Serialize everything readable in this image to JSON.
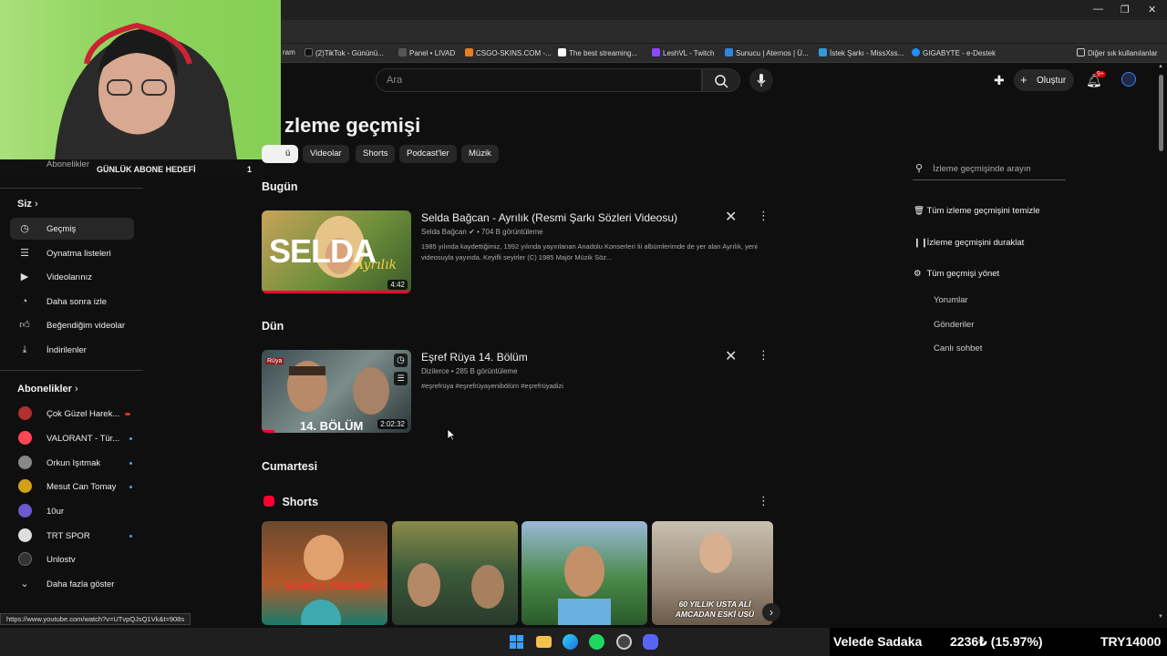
{
  "browser": {
    "bookmarks": [
      {
        "label": "ram",
        "color": "#c13584"
      },
      {
        "label": "(2)TikTok - Gününü...",
        "color": "#111111"
      },
      {
        "label": "Panel • LIVAD",
        "color": "#444444"
      },
      {
        "label": "CSGO-SKINS.COM -...",
        "color": "#e67e22"
      },
      {
        "label": "The best streaming...",
        "color": "#ffffff"
      },
      {
        "label": "LeshVL - Twitch",
        "color": "#9146ff"
      },
      {
        "label": "Sunucu | Aternos | Ü...",
        "color": "#2e86de"
      },
      {
        "label": "İstek Şarkı - MissXss...",
        "color": "#3498db"
      },
      {
        "label": "GIGABYTE - e-Destek",
        "color": "#1e90ff"
      },
      {
        "label": "Diğer sık kullanılanlar",
        "color": "#f1c40f"
      }
    ],
    "status_url": "https://www.youtube.com/watch?v=UTvpQJsQ1Vk&t=908s"
  },
  "header": {
    "search_placeholder": "Ara",
    "create_label": "Oluştur",
    "notifications_badge": "9+"
  },
  "overlay": {
    "goal_label": "GÜNLÜK ABONE HEDEFİ",
    "goal_value": "1"
  },
  "sidebar": {
    "subscriptions_top": "Abonelikler",
    "you_header": "Siz",
    "you_items": [
      {
        "label": "Geçmiş",
        "icon": "history-icon"
      },
      {
        "label": "Oynatma listeleri",
        "icon": "playlist-icon"
      },
      {
        "label": "Videolarınız",
        "icon": "your-videos-icon"
      },
      {
        "label": "Daha sonra izle",
        "icon": "watch-later-icon"
      },
      {
        "label": "Beğendiğim videolar",
        "icon": "like-icon"
      },
      {
        "label": "İndirilenler",
        "icon": "download-icon"
      }
    ],
    "subs_header": "Abonelikler",
    "subs": [
      {
        "label": "Çok Güzel Harek...",
        "color": "#b03030",
        "live": true
      },
      {
        "label": "VALORANT - Tür...",
        "color": "#ff4655",
        "live": false
      },
      {
        "label": "Orkun Işıtmak",
        "color": "#888888",
        "live": false
      },
      {
        "label": "Mesut Can Tomay",
        "color": "#d4a017",
        "live": false
      },
      {
        "label": "10ur",
        "color": "#6a5acd",
        "live": false
      },
      {
        "label": "TRT SPOR",
        "color": "#dddddd",
        "live": false
      },
      {
        "label": "Unlostv",
        "color": "#333333",
        "live": false
      }
    ],
    "show_more": "Daha fazla göster"
  },
  "main": {
    "title": "İzleme geçmişi",
    "title_visible": "zleme geçmişi",
    "chips": [
      "ü",
      "Videolar",
      "Shorts",
      "Podcast'ler",
      "Müzik"
    ],
    "sections": {
      "today": "Bugün",
      "yesterday": "Dün",
      "saturday": "Cumartesi"
    },
    "videos": [
      {
        "title": "Selda Bağcan - Ayrılık (Resmi Şarkı Sözleri Videosu)",
        "channel": "Selda Bağcan",
        "views": "704 B görüntüleme",
        "description": "1985 yılında kaydettiğimiz, 1992 yılında yayınlanan Anadolu Konserleri Iii albümlerimde de yer alan Ayrılık, yeni videosuyla yayında. Keyifli seyirler (C) 1985 Majör Müzik Söz...",
        "duration": "4:42",
        "thumb_text": "SELDA",
        "thumb_script": "Ayrılık"
      },
      {
        "title": "Eşref Rüya 14. Bölüm",
        "channel": "Dizilerce",
        "views": "285 B görüntüleme",
        "description": "#eşrefrüya #eşrefrüyayenibölüm #eşrefrüyadizi",
        "duration": "2:02:32",
        "thumb_text": "14. BÖLÜM",
        "thumb_badge": "Rüya"
      }
    ],
    "shorts_title": "Shorts",
    "shorts": [
      {
        "overlay": "SCHOLL THEORY"
      },
      {
        "overlay": ""
      },
      {
        "overlay": ""
      },
      {
        "overlay": "60 YILLIK USTA ALİ AMCADAN ESKİ USÜ"
      }
    ]
  },
  "right_panel": {
    "search_placeholder": "İzleme geçmişinde arayın",
    "clear": "Tüm izleme geçmişini temizle",
    "pause": "İzleme geçmişini duraklat",
    "manage": "Tüm geçmişi yönet",
    "sub_items": [
      "Yorumlar",
      "Gönderiler",
      "Canlı sohbet"
    ]
  },
  "ticker": {
    "name": "Velede Sadaka",
    "change": "2236₺ (15.97%)",
    "goal": "TRY14000"
  }
}
